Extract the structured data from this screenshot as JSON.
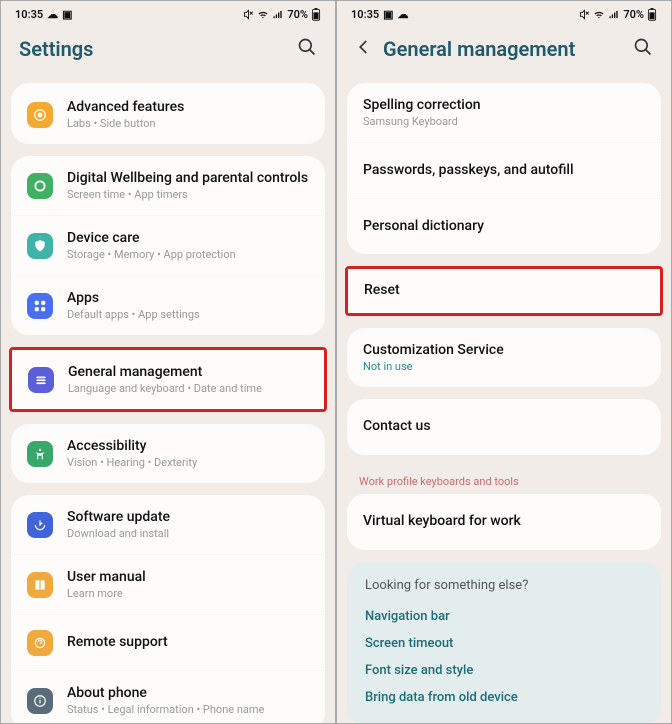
{
  "statusbar": {
    "time": "10:35",
    "battery_pct": "70%"
  },
  "left": {
    "header_title": "Settings",
    "items": [
      {
        "title": "Advanced features",
        "sub": "Labs  •  Side button",
        "color": "#f4a931"
      },
      {
        "title": "Digital Wellbeing and parental controls",
        "sub": "Screen time  •  App timers",
        "color": "#3fb064"
      },
      {
        "title": "Device care",
        "sub": "Storage  •  Memory  •  App protection",
        "color": "#3fb3a7"
      },
      {
        "title": "Apps",
        "sub": "Default apps  •  App settings",
        "color": "#4a6ef0"
      },
      {
        "title": "General management",
        "sub": "Language and keyboard  •  Date and time",
        "color": "#5b5fd8"
      },
      {
        "title": "Accessibility",
        "sub": "Vision  •  Hearing  •  Dexterity",
        "color": "#38a869"
      },
      {
        "title": "Software update",
        "sub": "Download and install",
        "color": "#3f63d8"
      },
      {
        "title": "User manual",
        "sub": "Learn more",
        "color": "#f0a93c"
      },
      {
        "title": "Remote support",
        "sub": "",
        "color": "#f0a93c"
      },
      {
        "title": "About phone",
        "sub": "Status  •  Legal information  •  Phone name",
        "color": "#5a6b7a"
      }
    ]
  },
  "right": {
    "header_title": "General management",
    "group1": [
      {
        "title": "Spelling correction",
        "sub": "Samsung Keyboard"
      },
      {
        "title": "Passwords, passkeys, and autofill",
        "sub": ""
      },
      {
        "title": "Personal dictionary",
        "sub": ""
      }
    ],
    "reset": {
      "title": "Reset"
    },
    "group3": [
      {
        "title": "Customization Service",
        "sub": "Not in use",
        "subclass": "teal"
      }
    ],
    "group4": [
      {
        "title": "Contact us",
        "sub": ""
      }
    ],
    "section_label": "Work profile keyboards and tools",
    "group5": [
      {
        "title": "Virtual keyboard for work",
        "sub": ""
      }
    ],
    "suggest": {
      "q": "Looking for something else?",
      "links": [
        "Navigation bar",
        "Screen timeout",
        "Font size and style",
        "Bring data from old device"
      ]
    }
  }
}
